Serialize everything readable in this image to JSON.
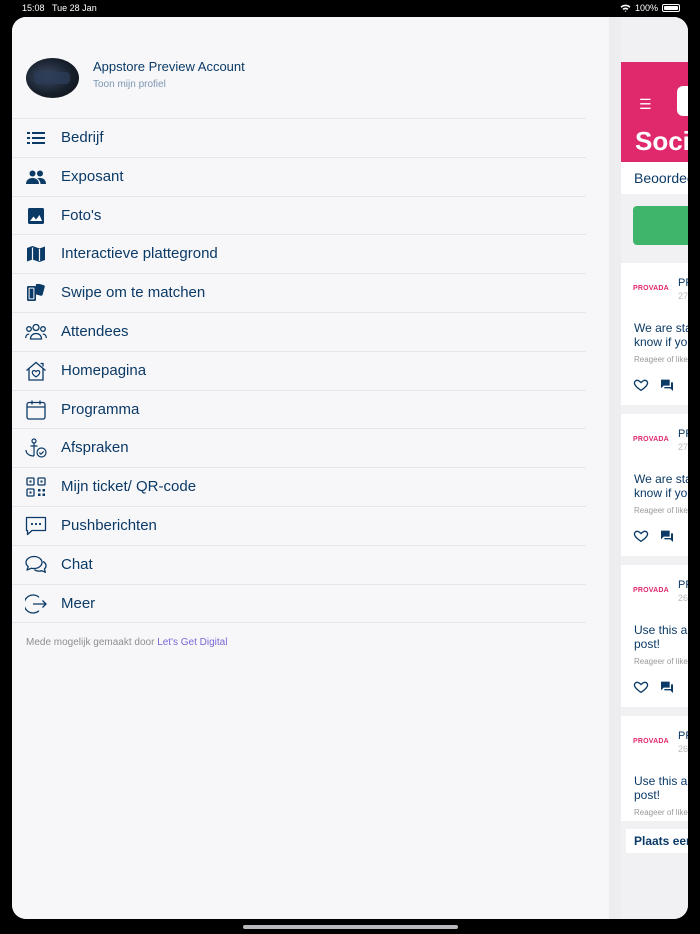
{
  "status_bar": {
    "time": "15:08",
    "date": "Tue 28 Jan",
    "battery": "100%"
  },
  "profile": {
    "name": "Appstore Preview Account",
    "link": "Toon mijn profiel"
  },
  "menu": {
    "items": [
      {
        "label": "Bedrijf",
        "icon": "list-icon"
      },
      {
        "label": "Exposant",
        "icon": "people-icon"
      },
      {
        "label": "Foto's",
        "icon": "image-icon"
      },
      {
        "label": "Interactieve plattegrond",
        "icon": "map-icon"
      },
      {
        "label": "Swipe om te matchen",
        "icon": "swipe-icon"
      },
      {
        "label": "Attendees",
        "icon": "attendees-icon"
      },
      {
        "label": "Homepagina",
        "icon": "home-heart-icon"
      },
      {
        "label": "Programma",
        "icon": "calendar-icon"
      },
      {
        "label": "Afspraken",
        "icon": "anchor-icon"
      },
      {
        "label": "Mijn ticket/ QR-code",
        "icon": "qr-code-icon"
      },
      {
        "label": "Pushberichten",
        "icon": "message-icon"
      },
      {
        "label": "Chat",
        "icon": "chat-icon"
      },
      {
        "label": "Meer",
        "icon": "logout-icon"
      }
    ]
  },
  "footer": {
    "prefix": "Mede mogelijk gemaakt door",
    "link": "Let's Get Digital"
  },
  "background_app": {
    "title": "Soci",
    "rating_text": "Beoordee",
    "posts": [
      {
        "logo": "PROVADA",
        "author": "PR",
        "date": "27",
        "text_line1": "We are sta",
        "text_line2": "know if yo",
        "hint": "Reageer of like"
      },
      {
        "logo": "PROVADA",
        "author": "PR",
        "date": "27",
        "text_line1": "We are sta",
        "text_line2": "know if yo",
        "hint": "Reageer of like"
      },
      {
        "logo": "PROVADA",
        "author": "PR",
        "date": "26",
        "text_line1": "Use this a",
        "text_line2": "post!",
        "hint": "Reageer of like"
      },
      {
        "logo": "PROVADA",
        "author": "PR",
        "date": "26",
        "text_line1": "Use this a",
        "text_line2": "post!",
        "hint": "Reageer of like"
      }
    ],
    "place_button": "Plaats een"
  },
  "colors": {
    "primary_text": "#0b3a66",
    "header_pink": "#e0286d",
    "green_button": "#3fb56b",
    "footer_link": "#7a67d8"
  }
}
